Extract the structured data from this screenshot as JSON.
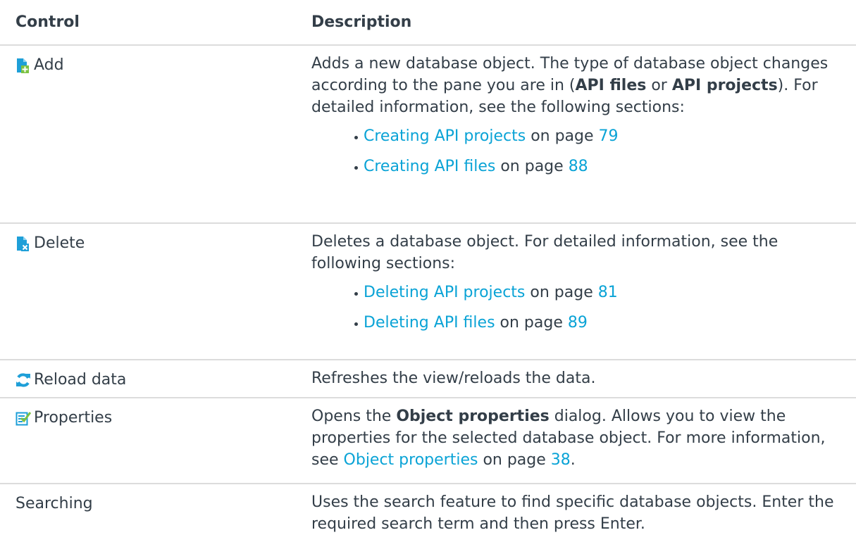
{
  "table": {
    "headers": {
      "control": "Control",
      "description": "Description"
    },
    "rows": {
      "add": {
        "icon": "add-file-icon",
        "control": "Add",
        "desc_p1": "Adds a new database object. The type of database object changes according to the pane you are in (",
        "bold1": "API files",
        "desc_p2": " or ",
        "bold2": "API projects",
        "desc_p3": "). For detailed information, see the following sections:",
        "refs": [
          {
            "link": "Creating API projects",
            "on_page": " on page ",
            "page": "79"
          },
          {
            "link": "Creating API files",
            "on_page": " on page ",
            "page": "88"
          }
        ]
      },
      "delete": {
        "icon": "delete-file-icon",
        "control": "Delete",
        "desc": "Deletes a database object. For detailed information, see the following sections:",
        "refs": [
          {
            "link": "Deleting API projects",
            "on_page": " on page ",
            "page": "81"
          },
          {
            "link": "Deleting API files",
            "on_page": " on page ",
            "page": "89"
          }
        ]
      },
      "reload": {
        "icon": "refresh-icon",
        "control": "Reload data",
        "desc": "Refreshes the view/reloads the data."
      },
      "properties": {
        "icon": "properties-icon",
        "control": "Properties",
        "desc_p1": "Opens the ",
        "bold1": "Object properties",
        "desc_p2": " dialog. Allows you to view the properties for the selected database object. For more information, see ",
        "link": "Object properties",
        "on_page": " on page ",
        "page": "38",
        "end": "."
      },
      "searching": {
        "control": "Searching",
        "desc": "Uses the search feature to find specific database objects. Enter the required search term and then press Enter."
      }
    }
  },
  "colors": {
    "link": "#0aa3d6",
    "icon_blue": "#1e9fd8",
    "icon_green": "#7cc242",
    "text": "#333e48"
  }
}
